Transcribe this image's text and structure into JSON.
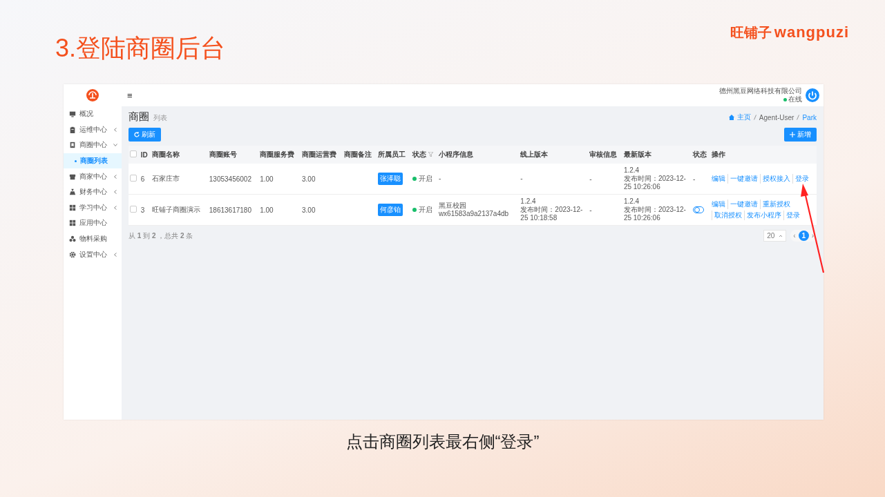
{
  "slide": {
    "title": "3.登陆商圈后台",
    "logo": {
      "cjk": "旺铺子",
      "latin": "wangpuzi"
    },
    "caption": "点击商圈列表最右侧“登录”"
  },
  "topbar": {
    "menu": "≡",
    "company": "德州黑豆网络科技有限公司",
    "status": "在线",
    "online": true
  },
  "sidebar": {
    "items": [
      {
        "label": "概况",
        "selected": false
      },
      {
        "label": "运维中心",
        "selected": false,
        "expanded": false
      },
      {
        "label": "商圈中心",
        "selected": false,
        "expanded": true,
        "children": [
          {
            "label": "商圈列表",
            "selected": true
          }
        ]
      },
      {
        "label": "商家中心",
        "selected": false,
        "expanded": false
      },
      {
        "label": "财务中心",
        "selected": false,
        "expanded": false
      },
      {
        "label": "学习中心",
        "selected": false,
        "expanded": false
      },
      {
        "label": "应用中心",
        "selected": false
      },
      {
        "label": "物料采购",
        "selected": false
      },
      {
        "label": "设置中心",
        "selected": false,
        "expanded": false
      }
    ]
  },
  "page": {
    "title": "商圈",
    "subtitle": "列表",
    "breadcrumb": [
      "主页",
      "Agent-User",
      "Park"
    ],
    "refresh_button": "刷新",
    "add_button": "新增"
  },
  "table": {
    "header_checked": false,
    "columns": [
      {
        "label": "ID"
      },
      {
        "label": "商圈名称"
      },
      {
        "label": "商圈账号"
      },
      {
        "label": "商圈服务费"
      },
      {
        "label": "商圈运营费"
      },
      {
        "label": "商圈备注"
      },
      {
        "label": "所属员工"
      },
      {
        "label": "状态",
        "filter": true
      },
      {
        "label": "小程序信息"
      },
      {
        "label": "线上版本"
      },
      {
        "label": "审核信息"
      },
      {
        "label": "最新版本"
      },
      {
        "label": "状态"
      },
      {
        "label": "操作"
      }
    ],
    "rows": [
      {
        "checked": false,
        "id": "6",
        "name": "石家庄市",
        "account": "13053456002",
        "service_fee": "1.00",
        "operation_fee": "3.00",
        "staff": "张泽聪",
        "status": "开启",
        "status_on": true,
        "mini_program": [
          "-"
        ],
        "online_version": [
          "-"
        ],
        "review": "-",
        "latest_version": [
          "1.2.4",
          "发布时间：2023-12-25 10:26:06"
        ],
        "state": {
          "kind": "text",
          "text": "-"
        },
        "actions": [
          "编辑",
          "一键邀请",
          "授权接入",
          "登录"
        ]
      },
      {
        "checked": false,
        "id": "3",
        "name": "旺铺子商圈演示",
        "account": "18613617180",
        "service_fee": "1.00",
        "operation_fee": "3.00",
        "staff": "何彦铂",
        "status": "开启",
        "status_on": true,
        "mini_program": [
          "黑豆校园",
          "wx61583a9a2137a4db"
        ],
        "online_version": [
          "1.2.4",
          "发布时间：2023-12-25 10:18:58"
        ],
        "review": "-",
        "latest_version": [
          "1.2.4",
          "发布时间：2023-12-25 10:26:06"
        ],
        "state": {
          "kind": "toggle",
          "on": false
        },
        "actions": [
          "编辑",
          "一键邀请",
          "重新授权",
          "取消授权",
          "发布小程序",
          "登录"
        ]
      }
    ]
  },
  "pagination": {
    "summary": "从 **1** 到 **2** ，总共 **2** 条",
    "page_size": "20",
    "prev": "‹",
    "next": "›",
    "pages": [
      {
        "label": "1",
        "selected": true
      }
    ]
  }
}
